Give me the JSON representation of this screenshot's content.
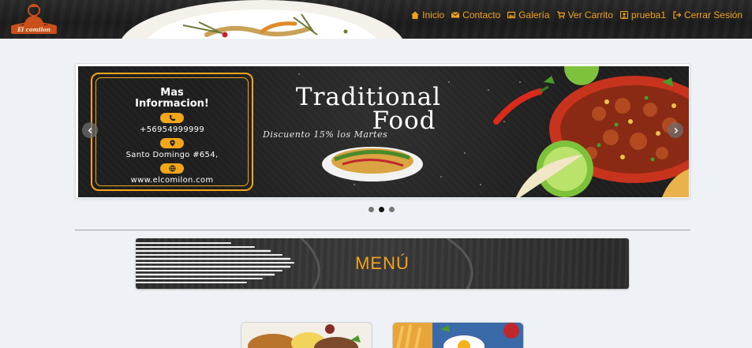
{
  "brand": {
    "logo_text": "El comilon"
  },
  "nav": {
    "items": [
      {
        "label": "Inicio",
        "icon": "home-icon"
      },
      {
        "label": "Contacto",
        "icon": "envelope-icon"
      },
      {
        "label": "Galería",
        "icon": "image-icon"
      },
      {
        "label": "Ver Carrito",
        "icon": "cart-icon"
      },
      {
        "label": "prueba1",
        "icon": "user-icon"
      },
      {
        "label": "Cerrar Sesión",
        "icon": "logout-icon"
      }
    ]
  },
  "carousel": {
    "info_title_1": "Mas",
    "info_title_2": "Informacion!",
    "phone": "+56954999999",
    "address": "Santo Domingo #654,",
    "website": "www.elcomilon.com",
    "headline_1": "Traditional",
    "headline_2": "Food",
    "subline": "Discuento 15% los Martes",
    "active_slide": 2,
    "slide_count": 3
  },
  "menu_section": {
    "title": "MENÚ"
  },
  "colors": {
    "accent": "#f0a31c",
    "navbar_bg": "#222222",
    "page_bg": "#eef1f5"
  }
}
